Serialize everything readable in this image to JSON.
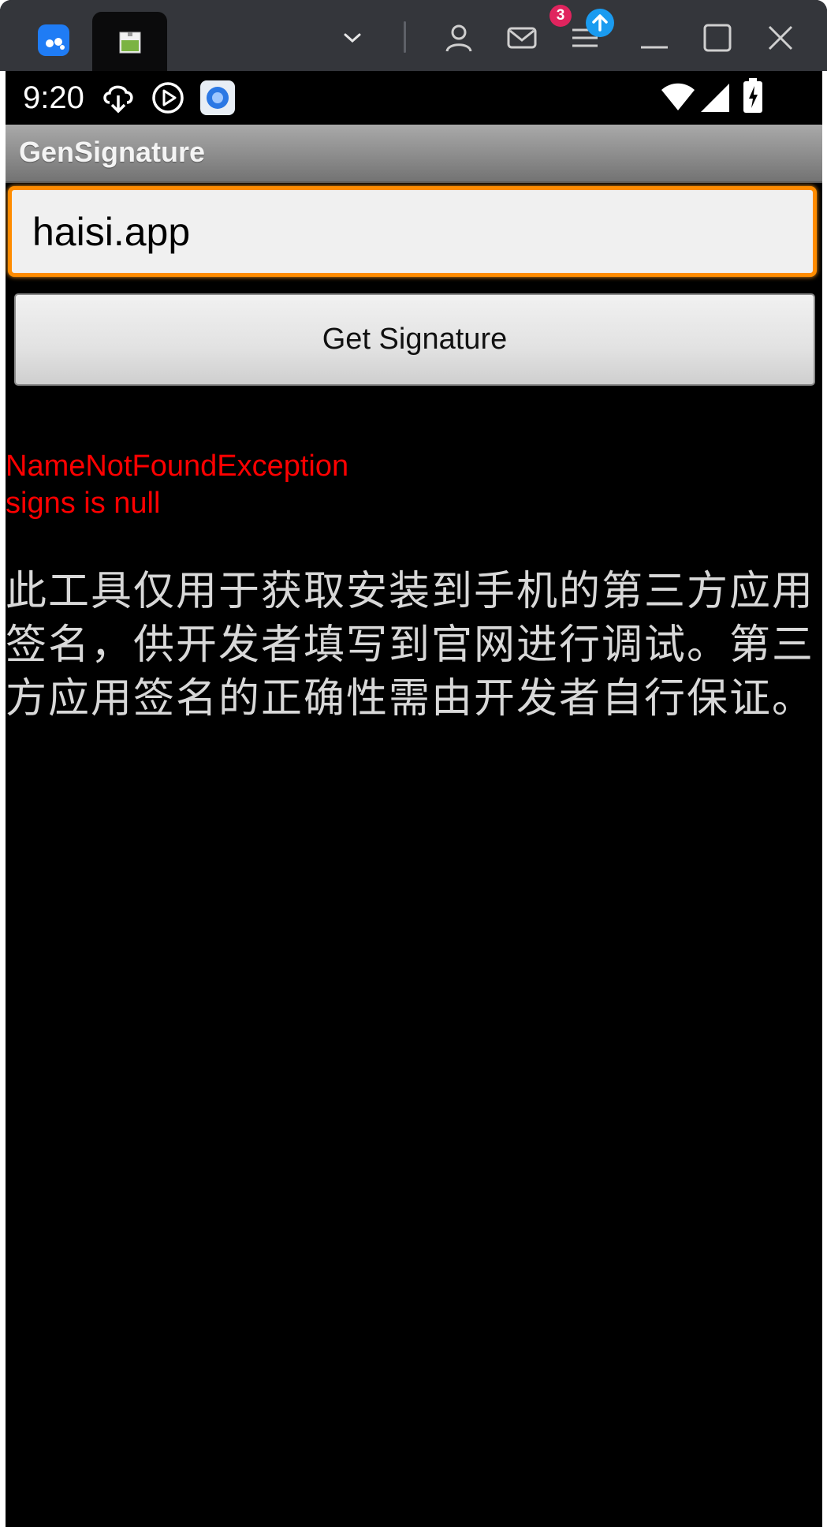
{
  "window": {
    "app_logo_text": "m",
    "notification_count": "3"
  },
  "statusbar": {
    "time": "9:20"
  },
  "app": {
    "title": "GenSignature",
    "package_input": {
      "value": "haisi.app"
    },
    "get_signature_button": "Get Signature",
    "result": {
      "error_line": "NameNotFoundException",
      "signs_line": "signs is null",
      "color": "#ff0000"
    },
    "description": "此工具仅用于获取安装到手机的第三方应用签名，供开发者填写到官网进行调试。第三方应用签名的正确性需由开发者自行保证。"
  },
  "colors": {
    "accent_focus": "#ff8c00",
    "titlebar": "#34363b",
    "badge": "#e0245e",
    "upload": "#1a9bf0"
  },
  "icons": {
    "app_logo": "moomoo-logo-icon",
    "tab_favicon": "android-app-icon",
    "dropdown": "chevron-down-icon",
    "profile": "person-icon",
    "mail": "mail-icon",
    "menu": "menu-icon",
    "upload": "upload-arrow-icon",
    "minimize": "minimize-icon",
    "maximize": "maximize-icon",
    "close": "close-icon",
    "download": "cloud-download-icon",
    "play": "play-circle-icon",
    "wifi": "wifi-icon",
    "signal": "signal-icon",
    "battery": "battery-charging-icon"
  }
}
